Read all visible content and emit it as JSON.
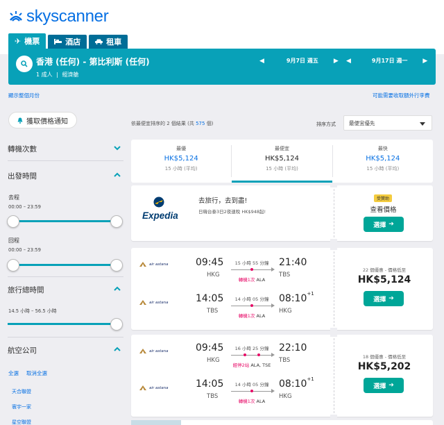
{
  "brand": {
    "name": "skyscanner",
    "color": "#0770e3"
  },
  "tabs": [
    {
      "label": "機票",
      "icon": "plane-icon",
      "active": true
    },
    {
      "label": "酒店",
      "icon": "bed-icon",
      "active": false
    },
    {
      "label": "租車",
      "icon": "car-icon",
      "active": false
    }
  ],
  "search": {
    "route": "香港 (任何) - 第比利斯 (任何)",
    "passengers": "1 成人",
    "cabin": "經濟艙",
    "depart_date": "9月7日 週五",
    "return_date": "9月17日 週一"
  },
  "links": {
    "month_view": "顯示整個月份",
    "extra_fees": "可能需要收取額外行李費"
  },
  "filters": {
    "alert_button": "獲取價格通知",
    "stops": "轉機次數",
    "depart_time": "出發時間",
    "outbound": "去程",
    "outbound_range": "00:00 – 23:59",
    "return": "回程",
    "return_range": "00:00 – 23:59",
    "duration": "旅行總時間",
    "duration_range": "14.5 小時 – 56.5 小時",
    "airlines": "航空公司",
    "select_all": "全選",
    "clear_all": "取消全選",
    "alliances": [
      "天合聯盟",
      "寰宇一家",
      "星空聯盟"
    ]
  },
  "results": {
    "count_text": "依最便宜排序的 2 個結果 (共 ",
    "total": "575",
    "count_suffix": " 個)",
    "sort_label": "排序方式",
    "sort_value": "最便宜優先"
  },
  "summary": [
    {
      "title": "最優",
      "price": "HK$5,124",
      "duration": "15 小時 (平均)"
    },
    {
      "title": "最便宜",
      "price": "HK$5,124",
      "duration": "15 小時 (平均)"
    },
    {
      "title": "最快",
      "price": "HK$5,124",
      "duration": "15 小時 (平均)"
    }
  ],
  "ad": {
    "logo_text": "Expedia",
    "headline": "去旅行，去到盡!",
    "subline": "日韓台泰3日2夜連稅 HK$948起!",
    "badge": "受贊助",
    "price_text": "查看價格",
    "select": "選擇"
  },
  "flights": [
    {
      "legs": [
        {
          "airline": "air astana",
          "dep": "09:45",
          "dep_code": "HKG",
          "dur": "15 小時 55 分鐘",
          "stops": "轉機1次",
          "via": "ALA",
          "arr": "21:40",
          "arr_code": "TBS",
          "plus": ""
        },
        {
          "airline": "air astana",
          "dep": "14:05",
          "dep_code": "TBS",
          "dur": "14 小時 05 分鐘",
          "stops": "轉機1次",
          "via": "ALA",
          "arr": "08:10",
          "arr_code": "HKG",
          "plus": "+1"
        }
      ],
      "deals": "22 個優惠 - 價格低至",
      "price": "HK$5,124",
      "select": "選擇"
    },
    {
      "legs": [
        {
          "airline": "air astana",
          "dep": "09:45",
          "dep_code": "HKG",
          "dur": "16 小時 25 分鐘",
          "stops": "經停2站",
          "via": "ALA, TSE",
          "arr": "22:10",
          "arr_code": "TBS",
          "plus": ""
        },
        {
          "airline": "air astana",
          "dep": "14:05",
          "dep_code": "TBS",
          "dur": "14 小時 05 分鐘",
          "stops": "轉機1次",
          "via": "ALA",
          "arr": "08:10",
          "arr_code": "HKG",
          "plus": "+1"
        }
      ],
      "deals": "18 個優惠 - 價格低至",
      "price": "HK$5,202",
      "select": "選擇"
    }
  ]
}
